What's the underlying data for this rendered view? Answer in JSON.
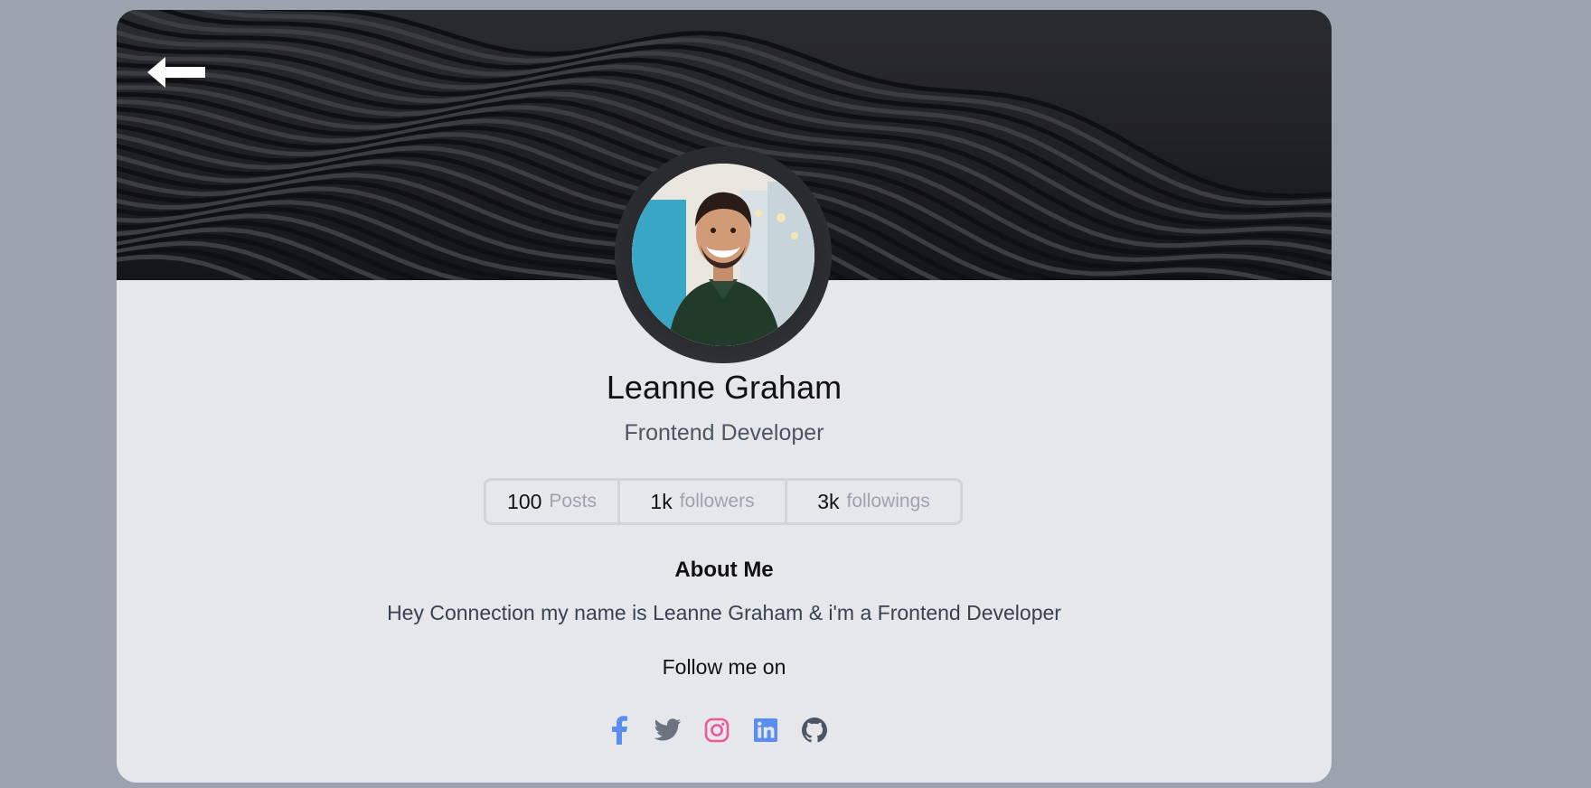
{
  "profile": {
    "name": "Leanne Graham",
    "role": "Frontend Developer"
  },
  "stats": [
    {
      "value": "100",
      "label": "Posts"
    },
    {
      "value": "1k",
      "label": "followers"
    },
    {
      "value": "3k",
      "label": "followings"
    }
  ],
  "about": {
    "title": "About Me",
    "text": "Hey Connection my name is Leanne Graham & i'm a Frontend Developer"
  },
  "follow": {
    "label": "Follow me on"
  },
  "socials": [
    {
      "icon": "facebook-icon",
      "color": "#5b8def"
    },
    {
      "icon": "twitter-icon",
      "color": "#6b7280"
    },
    {
      "icon": "instagram-icon",
      "color": "#e95b9c"
    },
    {
      "icon": "linkedin-icon",
      "color": "#5b8def"
    },
    {
      "icon": "github-icon",
      "color": "#4b5563"
    }
  ],
  "colors": {
    "page_bg": "#9ca3af",
    "card_bg": "#e5e7eb",
    "cover_bg": "#1c1d20",
    "muted_text": "#9ca3af"
  }
}
